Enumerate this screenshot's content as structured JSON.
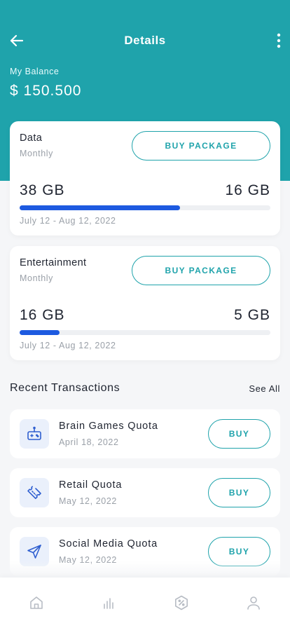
{
  "header": {
    "title": "Details",
    "back_icon": "arrow-left-icon",
    "menu_icon": "more-vertical-icon",
    "background_color": "#1fa3ab"
  },
  "balance": {
    "label": "My Balance",
    "value": "$ 150.500"
  },
  "packages": [
    {
      "name": "Data",
      "period": "Monthly",
      "button_label": "BUY PACKAGE",
      "total": "38 GB",
      "remaining": "16 GB",
      "progress": 0.64,
      "date_range": "July 12 - Aug 12, 2022"
    },
    {
      "name": "Entertainment",
      "period": "Monthly",
      "button_label": "BUY PACKAGE",
      "total": "16 GB",
      "remaining": "5 GB",
      "progress": 0.16,
      "date_range": "July 12 - Aug 12, 2022"
    }
  ],
  "transactions": {
    "title": "Recent Transactions",
    "see_all": "See All",
    "items": [
      {
        "name": "Brain Games Quota",
        "date": "April 18, 2022",
        "button_label": "BUY",
        "icon": "gamepad-icon"
      },
      {
        "name": "Retail Quota",
        "date": "May 12, 2022",
        "button_label": "BUY",
        "icon": "ticket-icon"
      },
      {
        "name": "Social Media Quota",
        "date": "May 12, 2022",
        "button_label": "BUY",
        "icon": "send-icon"
      }
    ]
  },
  "bottom_nav": {
    "items": [
      {
        "icon": "home-icon"
      },
      {
        "icon": "stats-icon"
      },
      {
        "icon": "discount-icon"
      },
      {
        "icon": "profile-icon"
      }
    ]
  },
  "colors": {
    "accent": "#1fa3ab",
    "progress": "#1d5ae0",
    "icon_blue": "#2f5fd0"
  }
}
